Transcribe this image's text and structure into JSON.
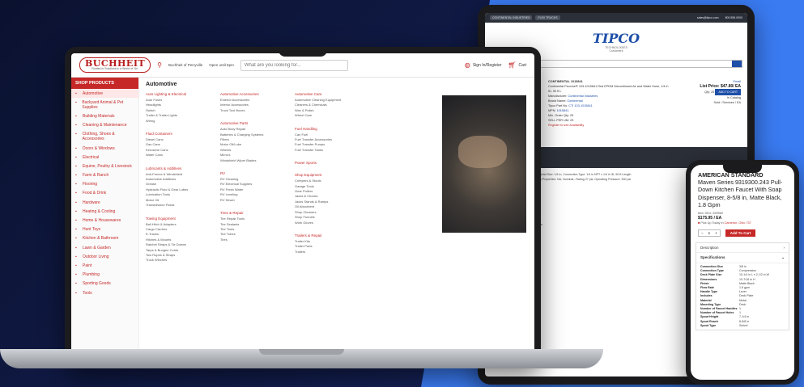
{
  "laptop": {
    "logo": {
      "word": "BUCHHEIT",
      "tagline": "Rooted in Solutions in a World of 'Un'"
    },
    "store": {
      "line1": "Buchheit of Perryville",
      "line2": "Open until 8pm"
    },
    "search_placeholder": "What are you looking for...",
    "signin": "Sign In/Register",
    "cart": "Cart",
    "shop_products": "SHOP PRODUCTS",
    "nav_items": [
      {
        "label": "Automotive",
        "icon": "car-icon",
        "active": true
      },
      {
        "label": "Backyard Animal & Pet Supplies",
        "icon": "paw-icon"
      },
      {
        "label": "Building Materials",
        "icon": "brick-icon"
      },
      {
        "label": "Cleaning & Maintenance",
        "icon": "broom-icon"
      },
      {
        "label": "Clothing, Shoes & Accessories",
        "icon": "shirt-icon"
      },
      {
        "label": "Doors & Windows",
        "icon": "door-icon"
      },
      {
        "label": "Electrical",
        "icon": "bolt-icon"
      },
      {
        "label": "Equine, Poultry & Livestock",
        "icon": "horse-icon"
      },
      {
        "label": "Farm & Ranch",
        "icon": "barn-icon"
      },
      {
        "label": "Flooring",
        "icon": "floor-icon"
      },
      {
        "label": "Food & Drink",
        "icon": "cup-icon"
      },
      {
        "label": "Hardware",
        "icon": "bolt-nut-icon"
      },
      {
        "label": "Heating & Cooling",
        "icon": "fan-icon"
      },
      {
        "label": "Home & Housewares",
        "icon": "home-icon"
      },
      {
        "label": "Hunt Toys",
        "icon": "target-icon"
      },
      {
        "label": "Kitchen & Bathroom",
        "icon": "faucet-icon"
      },
      {
        "label": "Lawn & Garden",
        "icon": "leaf-icon"
      },
      {
        "label": "Outdoor Living",
        "icon": "umbrella-icon"
      },
      {
        "label": "Paint",
        "icon": "brush-icon"
      },
      {
        "label": "Plumbing",
        "icon": "pipe-icon"
      },
      {
        "label": "Sporting Goods",
        "icon": "ball-icon"
      },
      {
        "label": "Tools",
        "icon": "wrench-icon"
      }
    ],
    "mega_title": "Automotive",
    "columns": [
      [
        {
          "title": "Auto Lighting & Electrical",
          "items": [
            "Auto Fuses",
            "Headlights",
            "Switch",
            "Trailer & Trailer Lights",
            "Wiring"
          ]
        },
        {
          "title": "Fluid Containers",
          "items": [
            "Diesel Cans",
            "Gas Cans",
            "Kerosene Cans",
            "Water Cans"
          ]
        },
        {
          "title": "Lubricants & Additives",
          "items": [
            "Anti-Freeze & Windshield",
            "Automotive Additives",
            "Grease",
            "Hydraulic Fluid & Gear Lubes",
            "Lubrication Tools",
            "Motor Oil",
            "Transmission Fluids"
          ]
        },
        {
          "title": "Towing Equipment",
          "items": [
            "Ball Hitch & Adapters",
            "Cargo Carriers",
            "E-Tracks",
            "Hitches & Mounts",
            "Ratchet Straps & Tie Downs",
            "Tarps & Bungee Cords",
            "Tow Ropes & Straps",
            "Truck Winches"
          ]
        }
      ],
      [
        {
          "title": "Automotive Accessories",
          "items": [
            "Exterior Accessories",
            "Interior Accessories",
            "Truck Tool Boxes"
          ]
        },
        {
          "title": "Automotive Parts",
          "items": [
            "Auto Body Repair",
            "Batteries & Charging Systems",
            "Filters",
            "Motor Oil/Lube",
            "Wheels",
            "Mirrors",
            "Windshield Wiper Blades"
          ]
        },
        {
          "title": "RV",
          "items": [
            "RV Cleaning",
            "RV Electrical Supplies",
            "RV Fresh Water",
            "RV Leveling",
            "RV Sewer"
          ]
        },
        {
          "title": "Tires & Repair",
          "items": [
            "Tire Repair Tools",
            "Tire Sealants",
            "Tire Tools",
            "Tire Tubes",
            "Tires"
          ]
        }
      ],
      [
        {
          "title": "Automotive Care",
          "items": [
            "Automotive Cleaning Equipment",
            "Cleaners & Chemicals",
            "Wax & Polish",
            "Wheel Care"
          ]
        },
        {
          "title": "Fuel Handling",
          "items": [
            "Can Fuel",
            "Fuel Transfer Accessories",
            "Fuel Transfer Pumps",
            "Fuel Transfer Tanks"
          ]
        },
        {
          "title": "Power Sports",
          "items": []
        },
        {
          "title": "Shop Equipment",
          "items": [
            "Creepers & Stools",
            "Garage Tools",
            "Gear Pullers",
            "Jacks & Chocks",
            "Jacks Stands & Ramps",
            "Oil Absorbent",
            "Shop Cleaners",
            "Shop Funnels",
            "Work Gloves"
          ]
        },
        {
          "title": "Trailers & Repair",
          "items": [
            "Trailer Kits",
            "Trailer Parts",
            "Trailers"
          ]
        }
      ]
    ]
  },
  "tablet": {
    "top_pills": [
      "CONTINENTAL INDUSTRIES",
      "FLEX TRUCKS"
    ],
    "email": "sales@tipco.com",
    "phone": "800.555.0000",
    "logo": "TIPCO",
    "logo_sub": "TECHNOLOGIES",
    "logo_tag": "Customized Solutions",
    "customers": "Customers",
    "product": {
      "part": "CONTINENTAL 1015841",
      "desc": "Continental Fluorine® 103-1015841 Red EPDM Discontinued Air and Water Hose, 1/4 in ID, 50 ft L",
      "manufacturer_label": "Manufacturer:",
      "manufacturer": "Continental Industries",
      "brand_label": "Brand Name:",
      "brand": "Continental",
      "tipco_label": "Tipco Part No:",
      "tipco_part": "CTI 103-1015841",
      "mpn_label": "MPN:",
      "mpn": "1015841",
      "min_label": "Min. Order Qty:",
      "min_qty": "25",
      "sell_label": "SELL PER UM:",
      "sell": "25",
      "register": "Register to see Availability",
      "email_link": "Email",
      "list_price": "List Price: $47.80/ EA",
      "qty_label": "Qty:",
      "qty": "25",
      "add": "ADD TO CART",
      "catalog": "In Catalog",
      "ships": "Sold / Services / EA"
    },
    "spec_lines": [
      "Discontinued Air and Water Hose, Material Size: 1/4 in, Connection Type: 1/4 in NPT x 1/4 in ID, 50 ft Length",
      "Red Synthetic Hose, Wall Construction Properties: NA, Nominal...Rating 27 psi, Operating Pressure: 300 psi",
      "Air and Water Hose",
      "250 psi",
      "1/4 in",
      "EPDM",
      "Tie Braided Spiral Synthetic Yarn",
      "50 ft",
      "Red",
      "Hose Sleeve",
      "Longer life",
      "Withstand the pull and surface abrasion",
      "Class C (limited oil resistance)",
      "Air, water and industrial application"
    ]
  },
  "phone": {
    "brand": "AMERICAN STANDARD",
    "title": "Maven Series 9319300.243 Pull-Down Kitchen Faucet With Soap Dispenser, 8-5/8 in, Matte Black, 1.8 Gpm",
    "item_label": "Item SKU:",
    "item": "699950",
    "price": "$175.95 / EA",
    "pickup": "Pick Up Today in",
    "pickup_link": "Cameron, Ohio 737",
    "qty": "1",
    "add": "Add To Cart",
    "description": "Description",
    "specs_title": "Specifications",
    "specs": [
      {
        "k": "Connection Size",
        "v": "3/8 in"
      },
      {
        "k": "Connection Type",
        "v": "Compression"
      },
      {
        "k": "Deck Plate Size",
        "v": "10-1/4 in L x 2-1/2 in W"
      },
      {
        "k": "Dimensions",
        "v": "10-7/16 in H"
      },
      {
        "k": "Finish",
        "v": "Matte Black"
      },
      {
        "k": "Flow Rate",
        "v": "1.8 gpm"
      },
      {
        "k": "Handle Type",
        "v": "Lever"
      },
      {
        "k": "Includes",
        "v": "Deck Plate"
      },
      {
        "k": "Material",
        "v": "Metal"
      },
      {
        "k": "Mounting Type",
        "v": "Deck"
      },
      {
        "k": "Number of Faucet Handles",
        "v": "1"
      },
      {
        "k": "Number of Faucet Holes",
        "v": "1"
      },
      {
        "k": "Spout Height",
        "v": "7-1/4 in"
      },
      {
        "k": "Spout Reach",
        "v": "8-5/8 in"
      },
      {
        "k": "Spout Type",
        "v": "Swivel"
      }
    ]
  },
  "colors": {
    "brand_red": "#c62828",
    "tipco_blue": "#1e4fa8",
    "bg_blue": "#3a7bf2"
  }
}
